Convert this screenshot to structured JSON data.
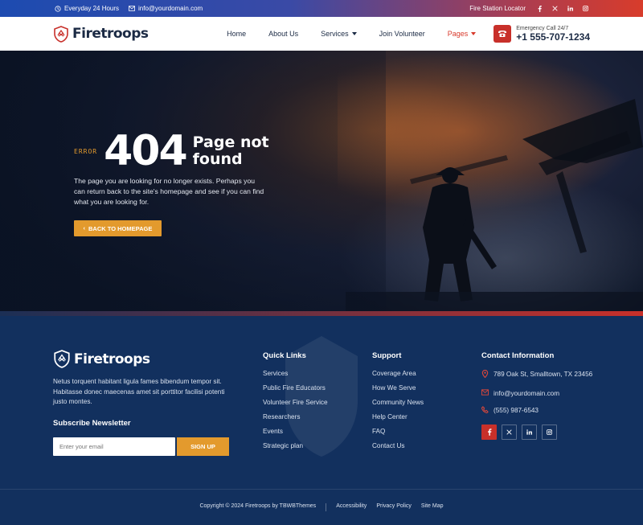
{
  "topbar": {
    "hours": "Everyday 24 Hours",
    "email": "info@yourdomain.com",
    "locator": "Fire Station Locator",
    "social": [
      "facebook-icon",
      "x-icon",
      "linkedin-icon",
      "instagram-icon"
    ]
  },
  "header": {
    "brand": "Firetroops",
    "nav": [
      {
        "label": "Home"
      },
      {
        "label": "About Us"
      },
      {
        "label": "Services",
        "dropdown": true
      },
      {
        "label": "Join Volunteer"
      },
      {
        "label": "Pages",
        "dropdown": true,
        "active": true
      }
    ],
    "emergency_label": "Emergency Call 24/7",
    "emergency_number": "+1 555-707-1234"
  },
  "hero": {
    "error_tag": "ERROR",
    "code": "404",
    "title_line1": "Page not",
    "title_line2": "found",
    "description": "The page you are looking for no longer exists. Perhaps you can return back to the site's homepage and see if you can find what you are looking for.",
    "button": "BACK TO HOMEPAGE"
  },
  "footer": {
    "brand": "Firetroops",
    "description": "Netus torquent habitant ligula fames bibendum tempor sit. Habitasse donec maecenas amet sit porttitor facilisi potenti justo montes.",
    "newsletter_title": "Subscribe Newsletter",
    "email_placeholder": "Enter your email",
    "signup": "SIGN UP",
    "quick_links_title": "Quick Links",
    "quick_links": [
      "Services",
      "Public Fire Educators",
      "Volunteer Fire Service",
      "Researchers",
      "Events",
      "Strategic plan"
    ],
    "support_title": "Support",
    "support_links": [
      "Coverage Area",
      "How We Serve",
      "Community News",
      "Help Center",
      "FAQ",
      "Contact Us"
    ],
    "contact_title": "Contact Information",
    "address": "789 Oak St, Smalltown, TX 23456",
    "email": "info@yourdomain.com",
    "phone": "(555) 987-6543",
    "copyright": "Copyright © 2024 Firetroops by TBWBThemes",
    "bottom_links": [
      "Accessibility",
      "Privacy Policy",
      "Site Map"
    ]
  },
  "colors": {
    "accent": "#e39a2d",
    "red": "#c8302a",
    "navy": "#12305e"
  }
}
